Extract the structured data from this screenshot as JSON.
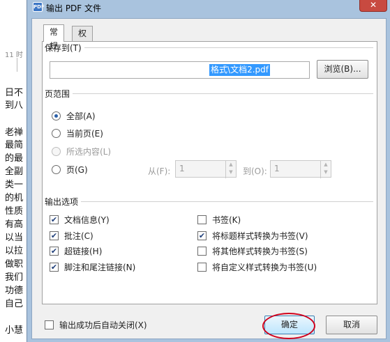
{
  "background_doc": {
    "time": "11 时",
    "lines": [
      "日不",
      "到八",
      "老禅",
      "最简",
      "的最",
      "全副",
      "类一",
      "的机",
      "性质",
      "有高",
      "以当",
      "以拉",
      "做职",
      "我们",
      "功德",
      "自己",
      "小慧"
    ]
  },
  "dialog": {
    "title": "输出 PDF 文件",
    "app_icon_text": "PDF",
    "close_glyph": "✕",
    "tabs": [
      "常规",
      "权限设置"
    ],
    "save_to": {
      "label": "保存到(T)",
      "path_value": "格式\\文档2.pdf",
      "browse_label": "浏览(B)..."
    },
    "page_range": {
      "label": "页范围",
      "options": [
        {
          "label": "全部(A)",
          "checked": true,
          "disabled": false
        },
        {
          "label": "当前页(E)",
          "checked": false,
          "disabled": false
        },
        {
          "label": "所选内容(L)",
          "checked": false,
          "disabled": true
        },
        {
          "label": "页(G)",
          "checked": false,
          "disabled": false
        }
      ],
      "from_label": "从(F):",
      "from_value": "1",
      "to_label": "到(O):",
      "to_value": "1"
    },
    "output_options": {
      "label": "输出选项",
      "left": [
        {
          "label": "文档信息(Y)",
          "checked": true
        },
        {
          "label": "批注(C)",
          "checked": true
        },
        {
          "label": "超链接(H)",
          "checked": true
        },
        {
          "label": "脚注和尾注链接(N)",
          "checked": true
        }
      ],
      "right": [
        {
          "label": "书签(K)",
          "checked": false
        },
        {
          "label": "将标题样式转换为书签(V)",
          "checked": true
        },
        {
          "label": "将其他样式转换为书签(S)",
          "checked": false
        },
        {
          "label": "将自定义样式转换为书签(U)",
          "checked": false
        }
      ]
    },
    "auto_close": {
      "label": "输出成功后自动关闭(X)",
      "checked": false
    },
    "ok_label": "确定",
    "cancel_label": "取消",
    "highlight_color": "#d0001b"
  }
}
